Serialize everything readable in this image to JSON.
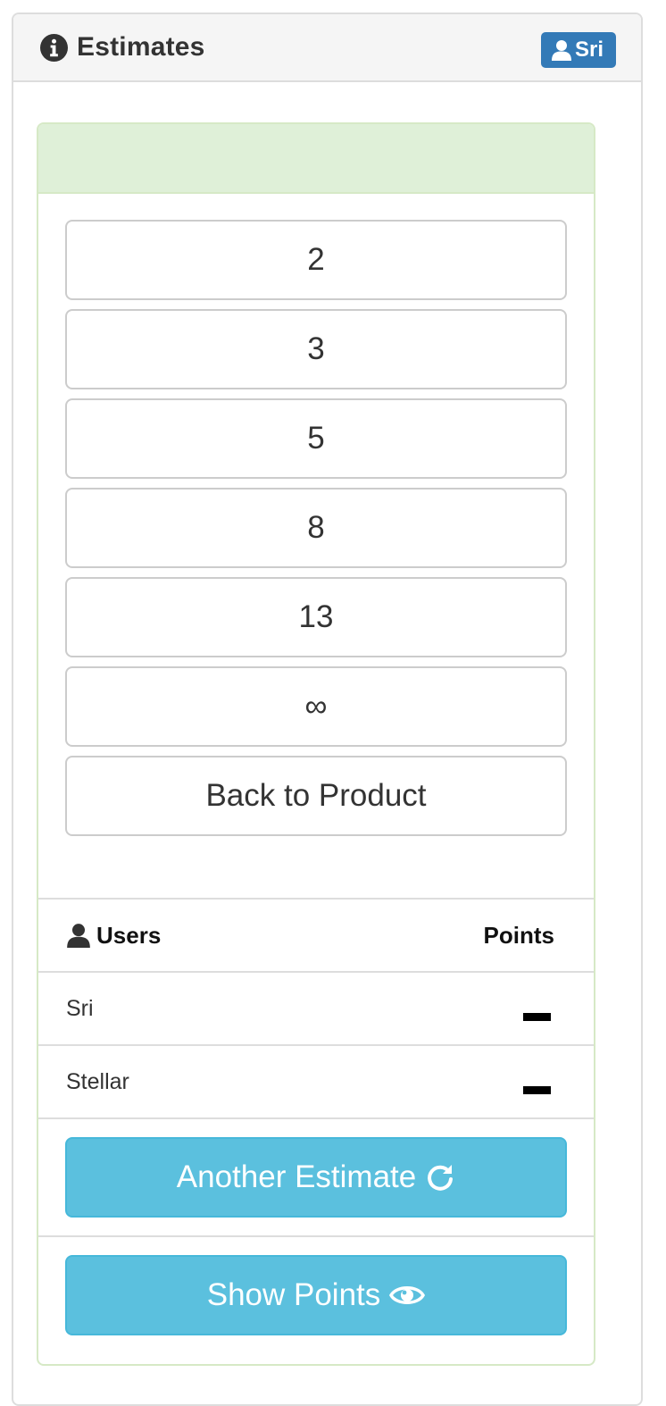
{
  "panel": {
    "title": "Estimates",
    "user_badge": "Sri"
  },
  "estimate_options": [
    "2",
    "3",
    "5",
    "8",
    "13",
    "∞"
  ],
  "back_button_label": "Back to Product",
  "table": {
    "users_header": "Users",
    "points_header": "Points",
    "rows": [
      {
        "name": "Sri",
        "points": "–"
      },
      {
        "name": "Stellar",
        "points": "–"
      }
    ]
  },
  "actions": {
    "another_estimate_label": "Another Estimate",
    "show_points_label": "Show Points"
  },
  "icons": {
    "title": "info-circle-icon",
    "badge": "user-icon",
    "users_header": "user-icon",
    "another_estimate": "refresh-icon",
    "show_points": "eye-icon"
  },
  "colors": {
    "primary": "#337ab7",
    "info": "#5bc0de",
    "success_bg": "#dff0d8"
  }
}
